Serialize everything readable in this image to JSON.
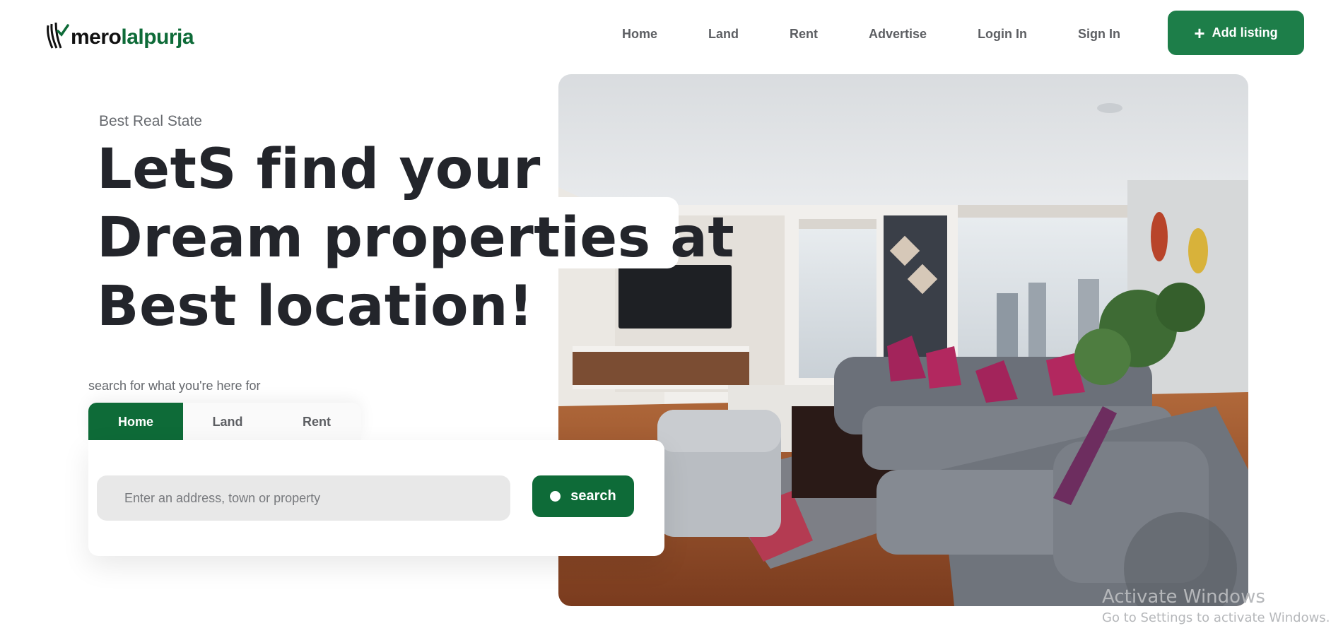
{
  "brand": {
    "part1": "mero",
    "part2": "lalpurja"
  },
  "nav": {
    "items": [
      "Home",
      "Land",
      "Rent",
      "Advertise",
      "Login In",
      "Sign In"
    ],
    "add_listing": "Add listing"
  },
  "hero": {
    "eyebrow": "Best Real State",
    "headline": [
      "LetS find your",
      "Dream properties at",
      "Best location!"
    ]
  },
  "search": {
    "hint": "search for what you're here for",
    "tabs": [
      "Home",
      "Land",
      "Rent"
    ],
    "active_tab": "Home",
    "placeholder": "Enter an address, town or property",
    "value": "",
    "button": "search"
  },
  "watermark": {
    "title": "Activate Windows",
    "subtitle": "Go to Settings to activate Windows."
  },
  "colors": {
    "brand_green": "#0e6b38",
    "button_green": "#1d7e49",
    "text_dark": "#23252b"
  },
  "icons": [
    "logo-mark-icon",
    "plus-icon",
    "search-icon"
  ]
}
